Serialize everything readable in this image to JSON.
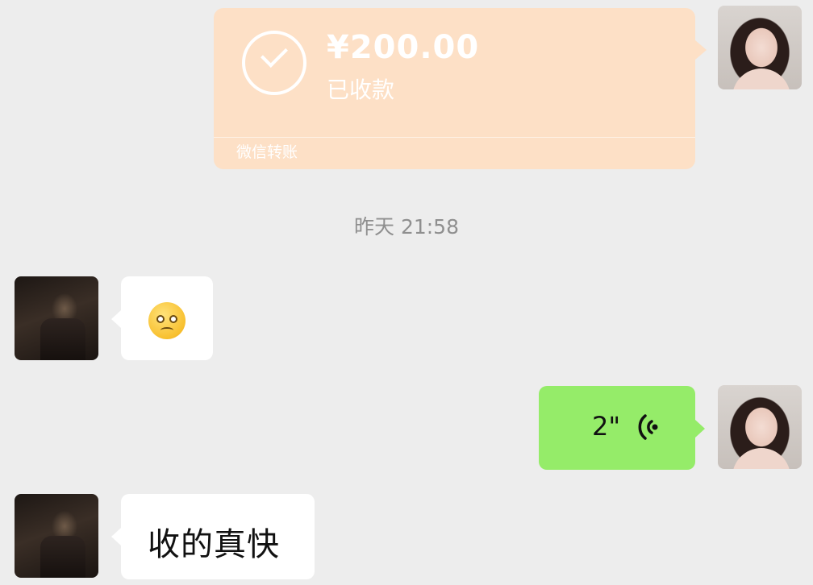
{
  "transfer": {
    "amount": "¥200.00",
    "status": "已收款",
    "footer": "微信转账"
  },
  "timestamp": "昨天 21:58",
  "messages": {
    "emoji_name": "awkward-emoji",
    "voice_duration": "2\"",
    "text": "收的真快"
  },
  "colors": {
    "background": "#ededed",
    "transfer_card": "#fde0c6",
    "sent_bubble": "#95ec69",
    "received_bubble": "#ffffff"
  }
}
